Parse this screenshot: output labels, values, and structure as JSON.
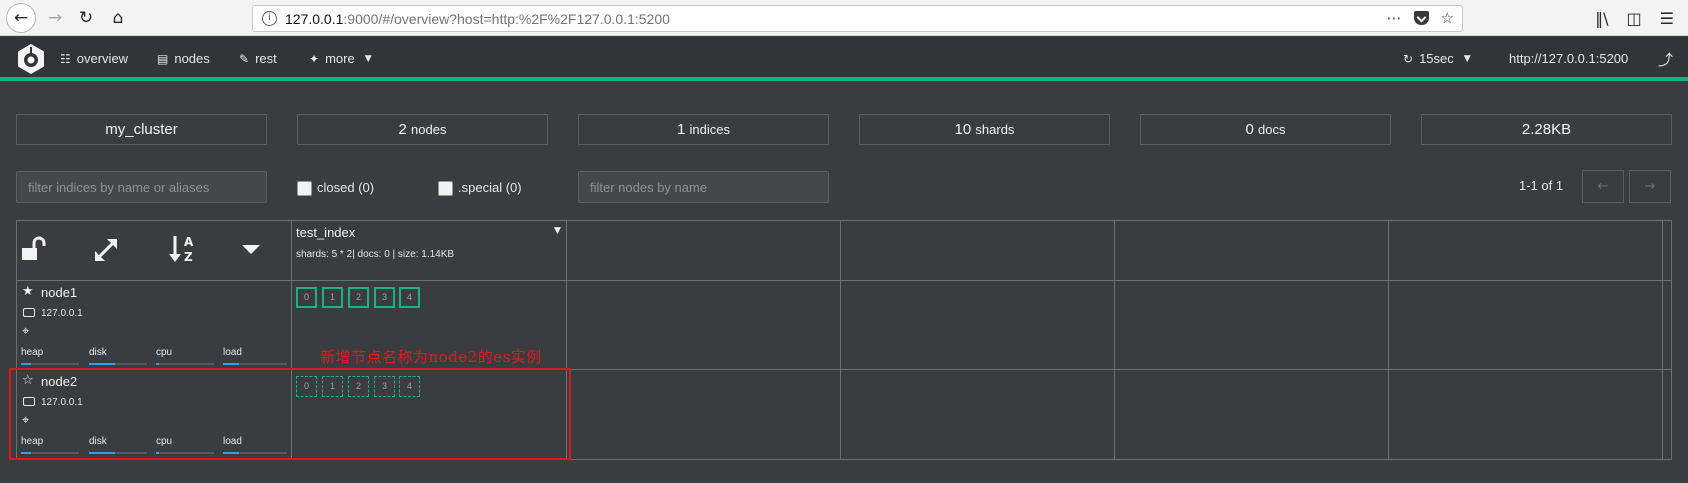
{
  "browser": {
    "url_host": "127.0.0.1",
    "url_rest": ":9000/#/overview?host=http:%2F%2F127.0.0.1:5200",
    "icons": [
      "back-icon",
      "forward-icon",
      "reload-icon",
      "home-icon",
      "info-icon",
      "more-icon",
      "pocket-icon",
      "bookmark-star-icon",
      "library-icon",
      "sidebar-icon"
    ]
  },
  "nav": {
    "items": [
      {
        "label": "overview",
        "icon": "sitemap-icon"
      },
      {
        "label": "nodes",
        "icon": "server-icon"
      },
      {
        "label": "rest",
        "icon": "edit-icon"
      },
      {
        "label": "more",
        "icon": "magic-icon"
      }
    ],
    "refresh_label": "15sec",
    "host_label": "http://127.0.0.1:5200",
    "accent_color": "#16b37f"
  },
  "stats": {
    "cluster_name": "my_cluster",
    "nodes_count": "2",
    "nodes_label": "nodes",
    "indices_count": "1",
    "indices_label": "indices",
    "shards_count": "10",
    "shards_label": "shards",
    "docs_count": "0",
    "docs_label": "docs",
    "size": "2.28KB"
  },
  "filters": {
    "indices_placeholder": "filter indices by name or aliases",
    "closed_label": "closed (0)",
    "special_label": ".special (0)",
    "nodes_placeholder": "filter nodes by name",
    "paging": "1-1 of 1",
    "prev_label": "←",
    "next_label": "→"
  },
  "index": {
    "name": "test_index",
    "meta": "shards: 5 * 2| docs: 0 | size: 1.14KB"
  },
  "nodes": [
    {
      "name": "node1",
      "ip": "127.0.0.1",
      "master": true,
      "shards": [
        "0",
        "1",
        "2",
        "3",
        "4"
      ],
      "shard_state": "started"
    },
    {
      "name": "node2",
      "ip": "127.0.0.1",
      "master": false,
      "shards": [
        "0",
        "1",
        "2",
        "3",
        "4"
      ],
      "shard_state": "unassigned"
    }
  ],
  "metrics": {
    "heap": "heap",
    "disk": "disk",
    "cpu": "cpu",
    "load": "load",
    "node1_levels": {
      "heap": 0.18,
      "disk": 0.45,
      "cpu": 0.06,
      "load": 0.25
    },
    "node2_levels": {
      "heap": 0.18,
      "disk": 0.45,
      "cpu": 0.06,
      "load": 0.25
    }
  },
  "annotation": {
    "text": "新增节点名称为node2的es实例",
    "color": "#e0191f"
  }
}
